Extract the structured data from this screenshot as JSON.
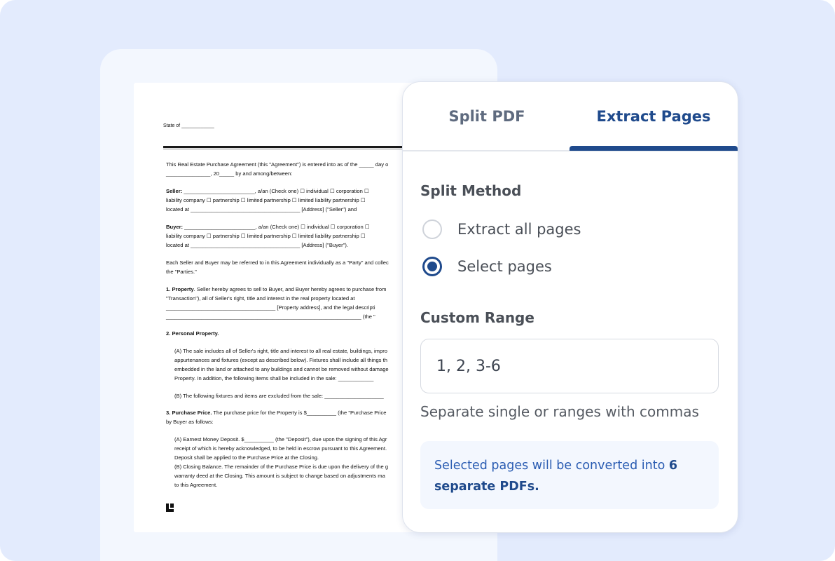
{
  "document": {
    "state_line": "State of ____________",
    "lines": [
      {
        "text": "This Real Estate Purchase Agreement (this \"Agreement\") is entered into as of the _____ day o",
        "indent": false
      },
      {
        "text": "_______________, 20_____ by and among/between:",
        "indent": false
      },
      {
        "text": "Seller: ________________________, a/an (Check one)  ☐  individual  ☐  corporation  ☐",
        "indent": false,
        "bold_lead": "Seller:"
      },
      {
        "text": "liability company  ☐  partnership  ☐  limited partnership  ☐  limited liability partnership  ☐",
        "indent": false
      },
      {
        "text": "located at _____________________________________ [Address] (\"Seller\") and",
        "indent": false
      },
      {
        "text": "Buyer: ________________________, a/an (Check one)  ☐  individual  ☐  corporation  ☐",
        "indent": false,
        "bold_lead": "Buyer:"
      },
      {
        "text": "liability company  ☐  partnership  ☐  limited partnership  ☐  limited liability partnership  ☐",
        "indent": false
      },
      {
        "text": "located at _____________________________________ [Address] (\"Buyer\").",
        "indent": false
      },
      {
        "text": "Each Seller and Buyer may be referred to in this Agreement individually as a \"Party\" and collec",
        "indent": false
      },
      {
        "text": "the \"Parties.\"",
        "indent": false
      },
      {
        "text": "1. Property. Seller hereby agrees to sell to Buyer, and Buyer hereby agrees to purchase from",
        "indent": false,
        "bold_lead": "1. Property"
      },
      {
        "text": "\"Transaction\"), all of Seller's right, title and interest in the real property located at",
        "indent": false
      },
      {
        "text": "_____________________________________ [Property address], and the legal descripti",
        "indent": false
      },
      {
        "text": "__________________________________________________________________ (the \"",
        "indent": false
      },
      {
        "text": "2. Personal Property.",
        "indent": false,
        "bold_lead": "2. Personal Property."
      },
      {
        "text": "(A) The sale includes all of Seller's right, title and interest to all real estate, buildings, impro",
        "indent": true
      },
      {
        "text": "appurtenances and fixtures (except as described below). Fixtures shall include all things th",
        "indent": true
      },
      {
        "text": "embedded in the land or attached to any buildings and cannot be removed without damage",
        "indent": true
      },
      {
        "text": "Property. In addition, the following items shall be included in the sale: ____________",
        "indent": true
      },
      {
        "text": "(B) The following fixtures and items are excluded from the sale: ____________________",
        "indent": true
      },
      {
        "text": "3. Purchase Price.  The purchase price for the Property is $__________ (the \"Purchase Price",
        "indent": false,
        "bold_lead": "3. Purchase Price."
      },
      {
        "text": "by Buyer as follows:",
        "indent": false
      },
      {
        "text": "(A) Earnest Money Deposit. $__________ (the \"Deposit\"), due upon the signing of this Agr",
        "indent": true
      },
      {
        "text": "receipt of which is hereby acknowledged, to be held in escrow pursuant to this Agreement.",
        "indent": true
      },
      {
        "text": "Deposit shall be applied to the Purchase Price at the Closing.",
        "indent": true
      },
      {
        "text": "(B) Closing Balance. The remainder of the Purchase Price is due upon the delivery of the g",
        "indent": true
      },
      {
        "text": "warranty deed at the Closing.  This amount is subject to change based on adjustments ma",
        "indent": true
      },
      {
        "text": "to this Agreement.",
        "indent": true
      }
    ]
  },
  "tabs": [
    {
      "label": "Split PDF",
      "active": false
    },
    {
      "label": "Extract Pages",
      "active": true
    }
  ],
  "split_method": {
    "heading": "Split Method",
    "options": [
      {
        "label": "Extract all pages",
        "selected": false
      },
      {
        "label": "Select pages",
        "selected": true
      }
    ]
  },
  "custom_range": {
    "heading": "Custom Range",
    "value": "1, 2, 3-6",
    "hint": "Separate single or ranges with commas"
  },
  "info": {
    "prefix": "Selected pages will be converted into ",
    "emphasis": "6 separate PDFs."
  },
  "colors": {
    "accent": "#1f4a8c",
    "background": "#e3ebfd",
    "info_text": "#2a5cb2"
  }
}
